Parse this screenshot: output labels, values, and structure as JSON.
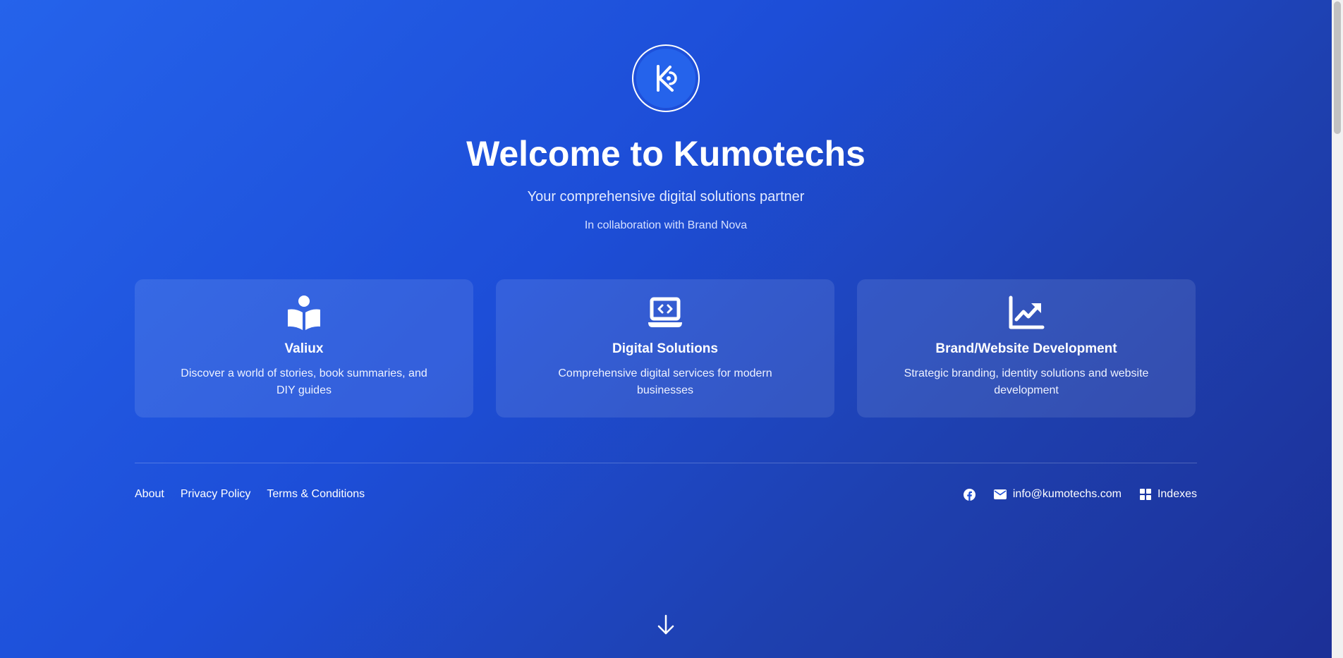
{
  "brand": {
    "logo_icon": "kumotechs-logo-icon",
    "title": "Welcome to Kumotechs",
    "subtitle": "Your comprehensive digital solutions partner",
    "collaboration": "In collaboration with Brand Nova"
  },
  "cards": [
    {
      "icon": "open-book-reader-icon",
      "title": "Valiux",
      "description": "Discover a world of stories, book summaries, and DIY guides"
    },
    {
      "icon": "laptop-code-icon",
      "title": "Digital Solutions",
      "description": "Comprehensive digital services for modern businesses"
    },
    {
      "icon": "chart-line-icon",
      "title": "Brand/Website Development",
      "description": "Strategic branding, identity solutions and website development"
    }
  ],
  "footer": {
    "links": [
      "About",
      "Privacy Policy",
      "Terms & Conditions"
    ],
    "facebook_icon": "facebook-icon",
    "email_icon": "mail-icon",
    "email": "info@kumotechs.com",
    "indexes_icon": "grid-icon",
    "indexes": "Indexes"
  },
  "scroll_hint_icon": "arrow-down-icon",
  "colors": {
    "gradient_start": "#2563eb",
    "gradient_end": "#1c2f96",
    "logo_fill": "#2563eb",
    "text": "#ffffff"
  }
}
